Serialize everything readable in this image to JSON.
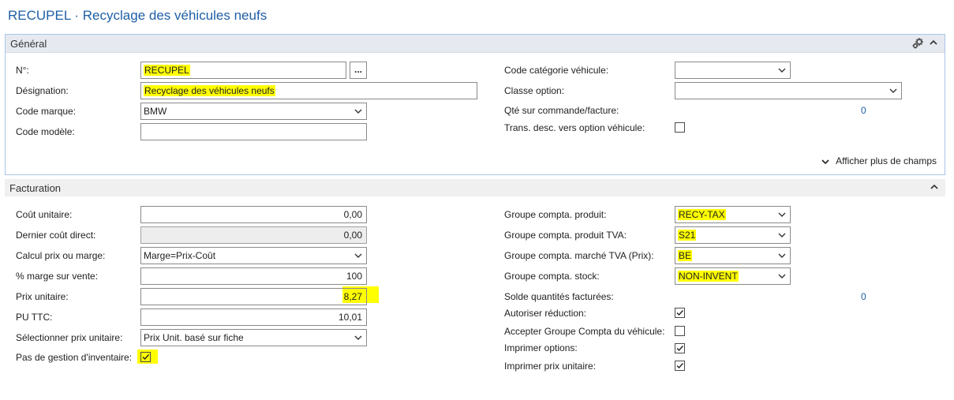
{
  "page": {
    "title": "RECUPEL · Recyclage des véhicules neufs"
  },
  "general": {
    "title": "Général",
    "no_label": "N°:",
    "no_value": "RECUPEL",
    "no_button": "...",
    "designation_label": "Désignation:",
    "designation_value": "Recyclage des véhicules neufs",
    "code_marque_label": "Code marque:",
    "code_marque_value": "BMW",
    "code_modele_label": "Code modèle:",
    "code_modele_value": "",
    "code_categorie_label": "Code catégorie véhicule:",
    "code_categorie_value": "",
    "classe_option_label": "Classe option:",
    "classe_option_value": "",
    "qte_commande_label": "Qté sur commande/facture:",
    "qte_commande_value": "0",
    "trans_desc_label": "Trans. desc. vers option véhicule:",
    "trans_desc_checked": false,
    "show_more_label": "Afficher plus de champs"
  },
  "facturation": {
    "title": "Facturation",
    "cout_unitaire_label": "Coût unitaire:",
    "cout_unitaire_value": "0,00",
    "dernier_cout_label": "Dernier coût direct:",
    "dernier_cout_value": "0,00",
    "calcul_prix_label": "Calcul prix ou marge:",
    "calcul_prix_value": "Marge=Prix-Coût",
    "marge_label": "% marge sur vente:",
    "marge_value": "100",
    "prix_unitaire_label": "Prix unitaire:",
    "prix_unitaire_value": "8,27",
    "pu_ttc_label": "PU TTC:",
    "pu_ttc_value": "10,01",
    "selection_prix_label": "Sélectionner prix unitaire:",
    "selection_prix_value": "Prix Unit. basé sur fiche",
    "pas_gestion_label": "Pas de gestion d'inventaire:",
    "pas_gestion_checked": true,
    "gr_produit_label": "Groupe compta. produit:",
    "gr_produit_value": "RECY-TAX",
    "gr_produit_tva_label": "Groupe compta. produit TVA:",
    "gr_produit_tva_value": "S21",
    "gr_marche_tva_label": "Groupe compta. marché TVA (Prix):",
    "gr_marche_tva_value": "BE",
    "gr_stock_label": "Groupe compta. stock:",
    "gr_stock_value": "NON-INVENT",
    "solde_qte_label": "Solde quantités facturées:",
    "solde_qte_value": "0",
    "autoriser_reduction_label": "Autoriser réduction:",
    "autoriser_reduction_checked": true,
    "accepter_groupe_label": "Accepter Groupe Compta du véhicule:",
    "accepter_groupe_checked": false,
    "imprimer_options_label": "Imprimer options:",
    "imprimer_options_checked": true,
    "imprimer_prix_label": "Imprimer prix unitaire:",
    "imprimer_prix_checked": true
  },
  "colors": {
    "accent": "#1f5fa6",
    "highlight": "#ffff00",
    "section_border": "#a9c6e6"
  },
  "icons": {
    "gear": "gear-icon",
    "collapse": "chevron-up-icon",
    "dropdown": "chevron-down-icon",
    "check": "checkmark-icon"
  }
}
